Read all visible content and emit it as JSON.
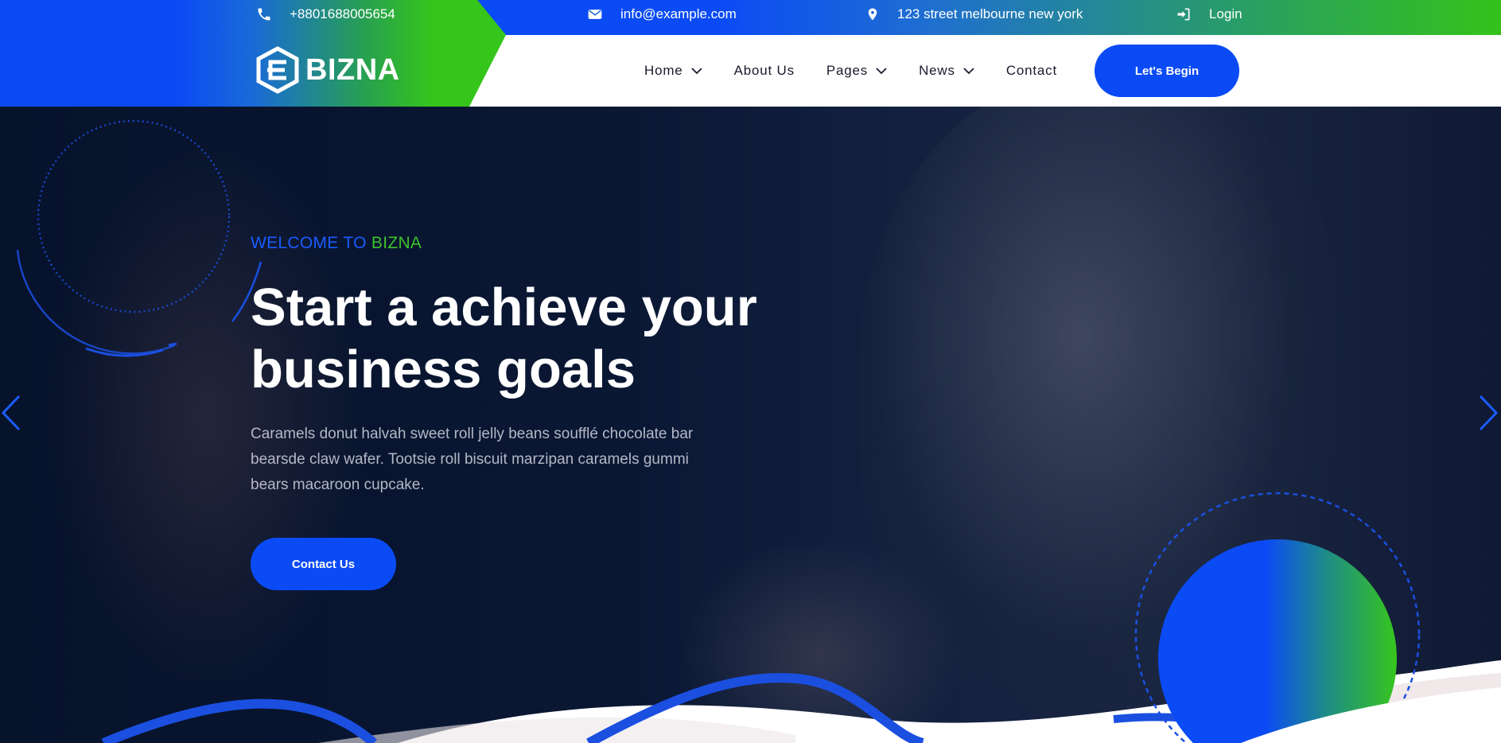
{
  "topbar": {
    "phone": "+8801688005654",
    "email": "info@example.com",
    "address": "123 street melbourne new york",
    "login": "Login"
  },
  "brand": {
    "name": "BIZNA"
  },
  "nav": {
    "items": [
      {
        "label": "Home",
        "has_dropdown": true
      },
      {
        "label": "About Us",
        "has_dropdown": false
      },
      {
        "label": "Pages",
        "has_dropdown": true
      },
      {
        "label": "News",
        "has_dropdown": true
      },
      {
        "label": "Contact",
        "has_dropdown": false
      }
    ],
    "cta": "Let's Begin"
  },
  "hero": {
    "welcome_prefix": "WELCOME TO",
    "welcome_brand": "BIZNA",
    "title": "Start a achieve your business goals",
    "description": "Caramels donut halvah sweet roll jelly beans soufflé chocolate bar bearsde claw wafer. Tootsie roll biscuit marzipan caramels gummi bears macaroon cupcake.",
    "button": "Contact Us"
  },
  "icons": {
    "phone": "phone-icon",
    "email": "envelope-icon",
    "address": "map-pin-icon",
    "login": "sign-in-icon",
    "logo": "hexagon-e-logo-icon",
    "dropdown": "chevron-down-icon",
    "prev": "chevron-left-icon",
    "next": "chevron-right-icon"
  },
  "colors": {
    "brand_blue": "#0b4bf5",
    "brand_green": "#36c51b",
    "hero_bg": "#0a1733",
    "text_white": "#ffffff"
  }
}
